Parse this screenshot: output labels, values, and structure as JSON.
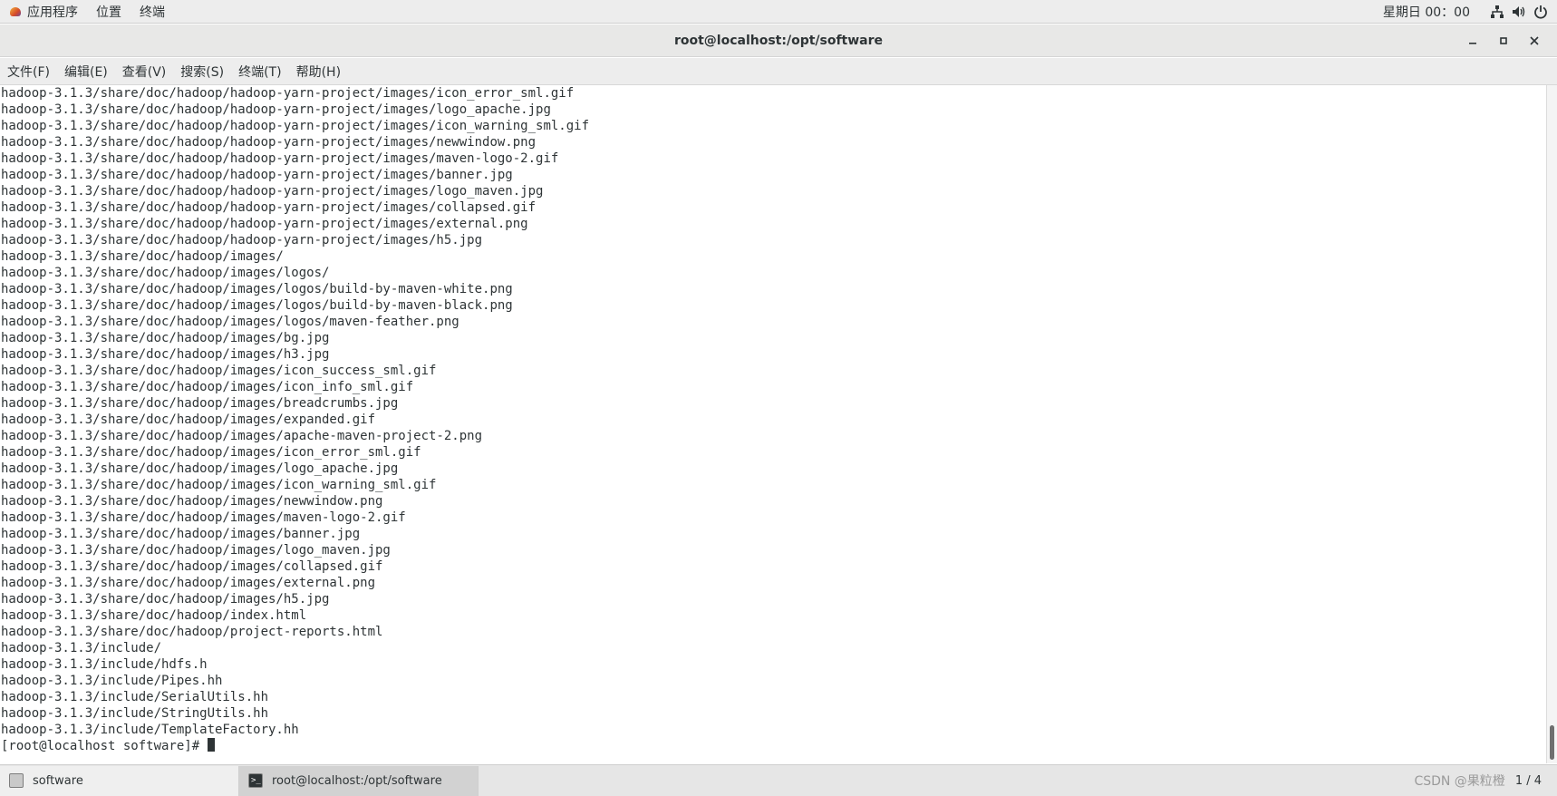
{
  "top_panel": {
    "applications": "应用程序",
    "places": "位置",
    "terminal": "终端",
    "clock": "星期日 00：00",
    "icons": [
      "network-icon",
      "volume-icon",
      "power-icon"
    ]
  },
  "window": {
    "title": "root@localhost:/opt/software",
    "minimize": "–",
    "maximize": "▫",
    "close": "✕"
  },
  "menu_bar": [
    "文件(F)",
    "编辑(E)",
    "查看(V)",
    "搜索(S)",
    "终端(T)",
    "帮助(H)"
  ],
  "terminal": {
    "lines": [
      "hadoop-3.1.3/share/doc/hadoop/hadoop-yarn-project/images/icon_error_sml.gif",
      "hadoop-3.1.3/share/doc/hadoop/hadoop-yarn-project/images/logo_apache.jpg",
      "hadoop-3.1.3/share/doc/hadoop/hadoop-yarn-project/images/icon_warning_sml.gif",
      "hadoop-3.1.3/share/doc/hadoop/hadoop-yarn-project/images/newwindow.png",
      "hadoop-3.1.3/share/doc/hadoop/hadoop-yarn-project/images/maven-logo-2.gif",
      "hadoop-3.1.3/share/doc/hadoop/hadoop-yarn-project/images/banner.jpg",
      "hadoop-3.1.3/share/doc/hadoop/hadoop-yarn-project/images/logo_maven.jpg",
      "hadoop-3.1.3/share/doc/hadoop/hadoop-yarn-project/images/collapsed.gif",
      "hadoop-3.1.3/share/doc/hadoop/hadoop-yarn-project/images/external.png",
      "hadoop-3.1.3/share/doc/hadoop/hadoop-yarn-project/images/h5.jpg",
      "hadoop-3.1.3/share/doc/hadoop/images/",
      "hadoop-3.1.3/share/doc/hadoop/images/logos/",
      "hadoop-3.1.3/share/doc/hadoop/images/logos/build-by-maven-white.png",
      "hadoop-3.1.3/share/doc/hadoop/images/logos/build-by-maven-black.png",
      "hadoop-3.1.3/share/doc/hadoop/images/logos/maven-feather.png",
      "hadoop-3.1.3/share/doc/hadoop/images/bg.jpg",
      "hadoop-3.1.3/share/doc/hadoop/images/h3.jpg",
      "hadoop-3.1.3/share/doc/hadoop/images/icon_success_sml.gif",
      "hadoop-3.1.3/share/doc/hadoop/images/icon_info_sml.gif",
      "hadoop-3.1.3/share/doc/hadoop/images/breadcrumbs.jpg",
      "hadoop-3.1.3/share/doc/hadoop/images/expanded.gif",
      "hadoop-3.1.3/share/doc/hadoop/images/apache-maven-project-2.png",
      "hadoop-3.1.3/share/doc/hadoop/images/icon_error_sml.gif",
      "hadoop-3.1.3/share/doc/hadoop/images/logo_apache.jpg",
      "hadoop-3.1.3/share/doc/hadoop/images/icon_warning_sml.gif",
      "hadoop-3.1.3/share/doc/hadoop/images/newwindow.png",
      "hadoop-3.1.3/share/doc/hadoop/images/maven-logo-2.gif",
      "hadoop-3.1.3/share/doc/hadoop/images/banner.jpg",
      "hadoop-3.1.3/share/doc/hadoop/images/logo_maven.jpg",
      "hadoop-3.1.3/share/doc/hadoop/images/collapsed.gif",
      "hadoop-3.1.3/share/doc/hadoop/images/external.png",
      "hadoop-3.1.3/share/doc/hadoop/images/h5.jpg",
      "hadoop-3.1.3/share/doc/hadoop/index.html",
      "hadoop-3.1.3/share/doc/hadoop/project-reports.html",
      "hadoop-3.1.3/include/",
      "hadoop-3.1.3/include/hdfs.h",
      "hadoop-3.1.3/include/Pipes.hh",
      "hadoop-3.1.3/include/SerialUtils.hh",
      "hadoop-3.1.3/include/StringUtils.hh",
      "hadoop-3.1.3/include/TemplateFactory.hh"
    ],
    "prompt": "[root@localhost software]# "
  },
  "taskbar": {
    "tasks": [
      {
        "label": "software",
        "icon": "files-icon"
      },
      {
        "label": "root@localhost:/opt/software",
        "icon": "terminal-icon"
      }
    ],
    "watermark": "CSDN @果粒橙",
    "workspace": "1 / 4"
  }
}
